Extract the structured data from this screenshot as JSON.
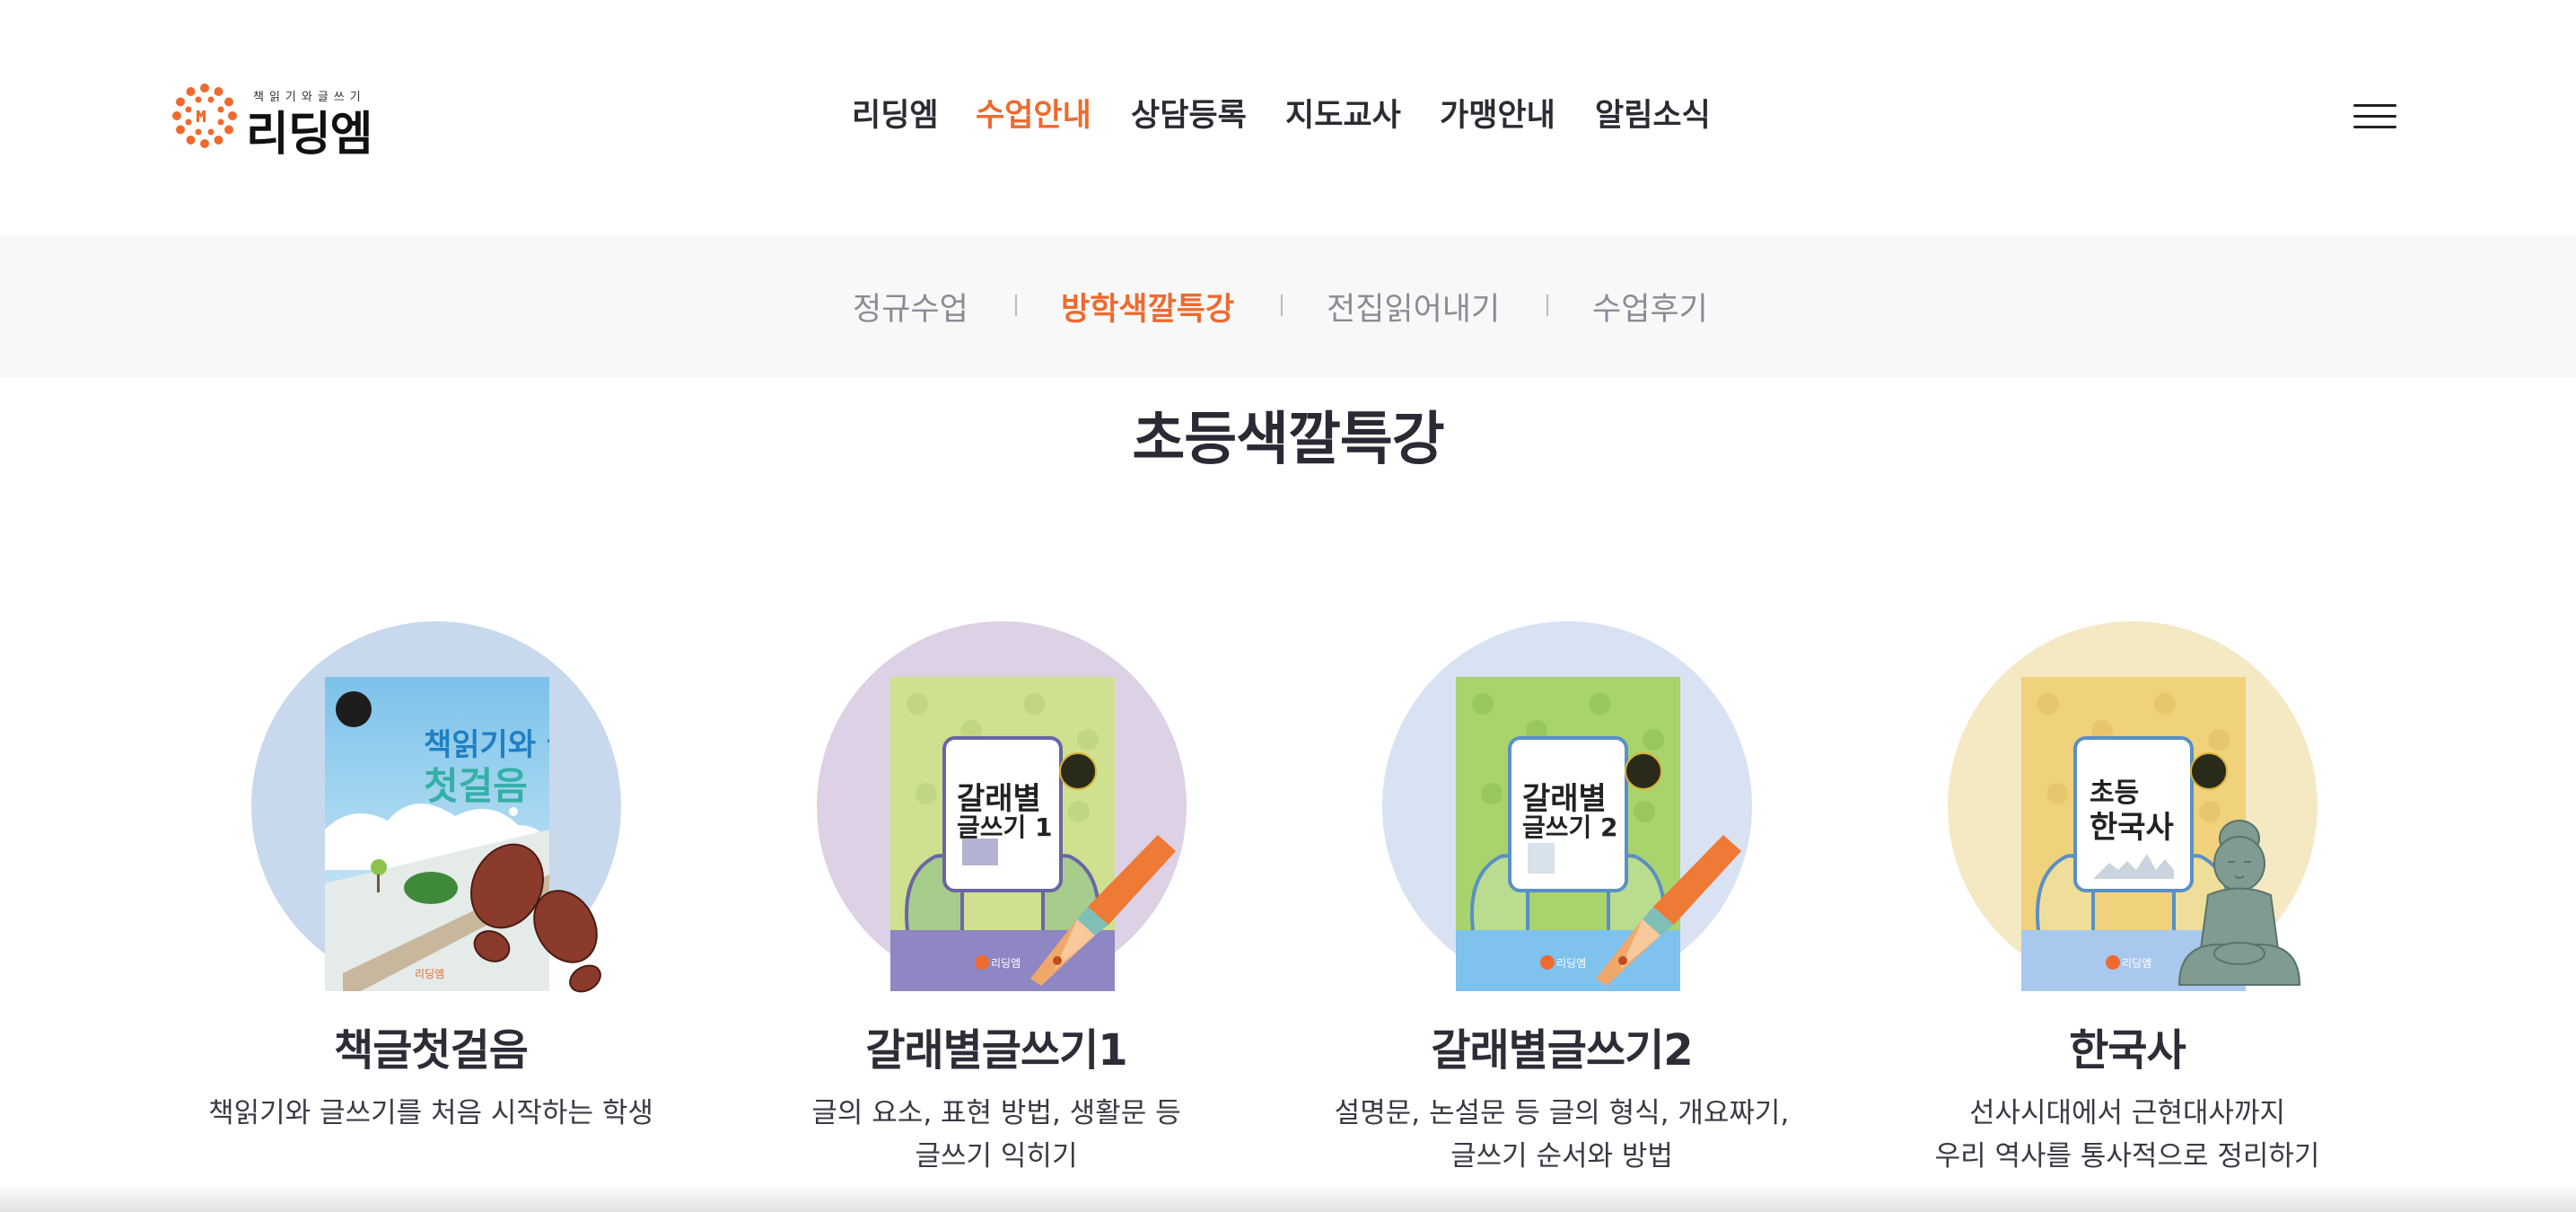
{
  "header": {
    "logo": {
      "tagline": "책읽기와글쓰기",
      "name": "리딩엠"
    },
    "nav": [
      {
        "label": "리딩엠",
        "active": false
      },
      {
        "label": "수업안내",
        "active": true
      },
      {
        "label": "상담등록",
        "active": false
      },
      {
        "label": "지도교사",
        "active": false
      },
      {
        "label": "가맹안내",
        "active": false
      },
      {
        "label": "알림소식",
        "active": false
      }
    ],
    "menu_icon": "hamburger-menu-icon"
  },
  "subnav": {
    "items": [
      {
        "label": "정규수업",
        "active": false
      },
      {
        "label": "방학색깔특강",
        "active": true
      },
      {
        "label": "전집읽어내기",
        "active": false
      },
      {
        "label": "수업후기",
        "active": false
      }
    ]
  },
  "page": {
    "title": "초등색깔특강"
  },
  "courses": [
    {
      "name": "책글첫걸음",
      "description": [
        "책읽기와 글쓰기를 처음 시작하는 학생"
      ],
      "circle_color": "#c8d9ee",
      "book": {
        "title_line1": "책읽기와 글쓰기",
        "title_line2": "첫걸음",
        "badge": "리딩엠",
        "publisher": "리딩엠"
      },
      "decoration": "footprints-icon"
    },
    {
      "name": "갈래별글쓰기1",
      "description": [
        "글의 요소, 표현 방법, 생활문 등",
        "글쓰기 익히기"
      ],
      "circle_color": "#ddd1e6",
      "book": {
        "title_line1": "갈래별",
        "title_line2": "글쓰기 1",
        "badge": "리딩엠",
        "publisher": "리딩엠"
      },
      "decoration": "fountain-pen-icon"
    },
    {
      "name": "갈래별글쓰기2",
      "description": [
        "설명문, 논설문 등 글의 형식, 개요짜기,",
        "글쓰기 순서와 방법"
      ],
      "circle_color": "#d8e2f2",
      "book": {
        "title_line1": "갈래별",
        "title_line2": "글쓰기 2",
        "badge": "리딩엠",
        "publisher": "리딩엠"
      },
      "decoration": "fountain-pen-icon"
    },
    {
      "name": "한국사",
      "description": [
        "선사시대에서 근현대사까지",
        "우리 역사를 통사적으로 정리하기"
      ],
      "circle_color": "#f5e9c4",
      "book": {
        "title_line1": "초등",
        "title_line2": "한국사",
        "badge": "리딩엠",
        "publisher": "리딩엠"
      },
      "decoration": "buddha-statue-icon"
    }
  ],
  "colors": {
    "accent": "#ee6a2e",
    "text": "#2b2b33",
    "subnav_bg": "#f8f8f9"
  }
}
